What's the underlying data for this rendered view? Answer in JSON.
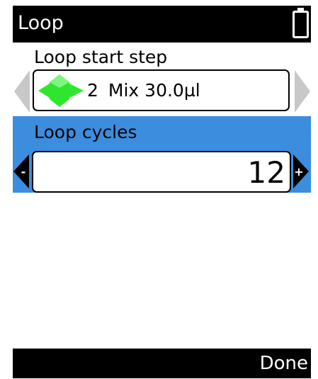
{
  "title_bar": {
    "title": "Loop",
    "battery_icon": "battery-icon"
  },
  "loop_start": {
    "label": "Loop start step",
    "step_number": "2",
    "step_text": "Mix 30.0µl",
    "step_icon": "mix-step-icon",
    "icon_color": "#2ee62e"
  },
  "loop_cycles": {
    "label": "Loop cycles",
    "value": "12",
    "decrement_symbol": "-",
    "increment_symbol": "+",
    "highlight_color": "#3c8dde"
  },
  "footer": {
    "done_label": "Done"
  }
}
